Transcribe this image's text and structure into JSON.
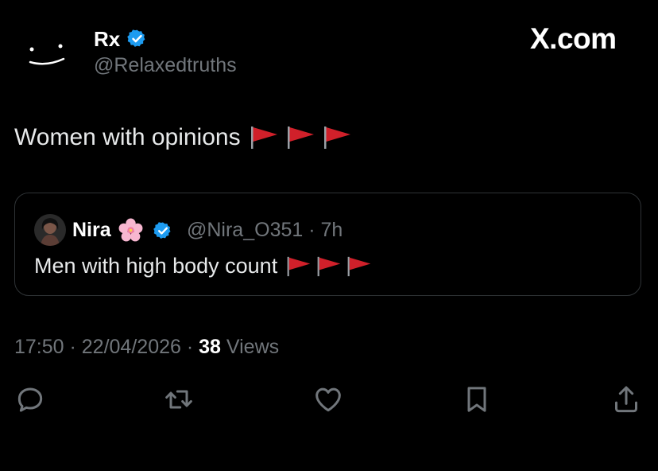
{
  "author": {
    "name": "Rx",
    "handle": "@Relaxedtruths",
    "verified": true,
    "avatar_icon": "smiley-face-icon"
  },
  "brand": "X.com",
  "tweet": {
    "text": "Women with opinions",
    "emoji_flags": 3,
    "flag_icon": "red-flag-icon"
  },
  "quote": {
    "name": "Nira",
    "name_emoji": "cherry-blossom-icon",
    "verified": true,
    "handle_time": "@Nira_O351 · 7h",
    "text": "Men with high body count",
    "emoji_flags": 3
  },
  "meta": {
    "time_date": "17:50 · 22/04/2026 · ",
    "views_count": "38",
    "views_label": " Views"
  },
  "actions": [
    {
      "name": "reply",
      "icon": "reply-icon"
    },
    {
      "name": "retweet",
      "icon": "retweet-icon"
    },
    {
      "name": "like",
      "icon": "heart-icon"
    },
    {
      "name": "bookmark",
      "icon": "bookmark-icon"
    },
    {
      "name": "share",
      "icon": "share-icon"
    }
  ],
  "colors": {
    "background": "#000000",
    "text": "#e7e9ea",
    "muted": "#71767b",
    "verified": "#1d9bf0",
    "flag": "#d0202a",
    "border": "#2f3336"
  }
}
